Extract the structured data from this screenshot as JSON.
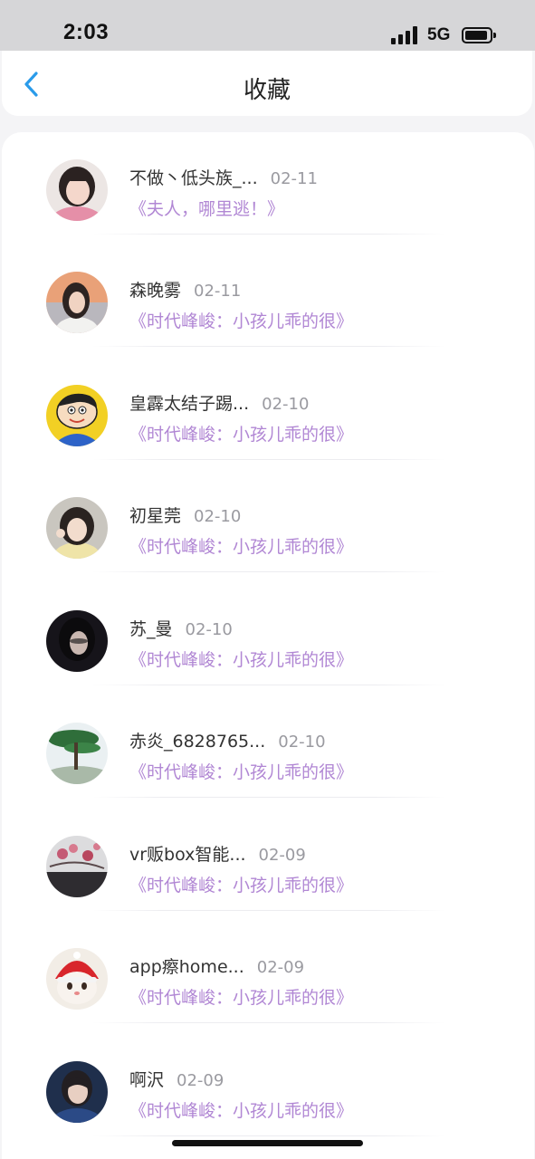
{
  "status_bar": {
    "time": "2:03",
    "network": "5G"
  },
  "header": {
    "title": "收藏",
    "back_icon": "chevron-left-icon"
  },
  "colors": {
    "accent_blue": "#2a9bea",
    "book_title_purple": "#b187d4",
    "date_gray": "#9a9aa0"
  },
  "favorites": [
    {
      "name": "不做丶低头族_...",
      "date": "02-11",
      "book": "《夫人，哪里逃！》"
    },
    {
      "name": "森晚雾",
      "date": "02-11",
      "book": "《时代峰峻：小孩儿乖的很》"
    },
    {
      "name": "皇霹太结子踢...",
      "date": "02-10",
      "book": "《时代峰峻：小孩儿乖的很》"
    },
    {
      "name": "初星莞",
      "date": "02-10",
      "book": "《时代峰峻：小孩儿乖的很》"
    },
    {
      "name": "苏_曼",
      "date": "02-10",
      "book": "《时代峰峻：小孩儿乖的很》"
    },
    {
      "name": "赤炎_6828765...",
      "date": "02-10",
      "book": "《时代峰峻：小孩儿乖的很》"
    },
    {
      "name": "vr贩box智能...",
      "date": "02-09",
      "book": "《时代峰峻：小孩儿乖的很》"
    },
    {
      "name": "app瘵home...",
      "date": "02-09",
      "book": "《时代峰峻：小孩儿乖的很》"
    },
    {
      "name": "啊沢",
      "date": "02-09",
      "book": "《时代峰峻：小孩儿乖的很》"
    }
  ]
}
